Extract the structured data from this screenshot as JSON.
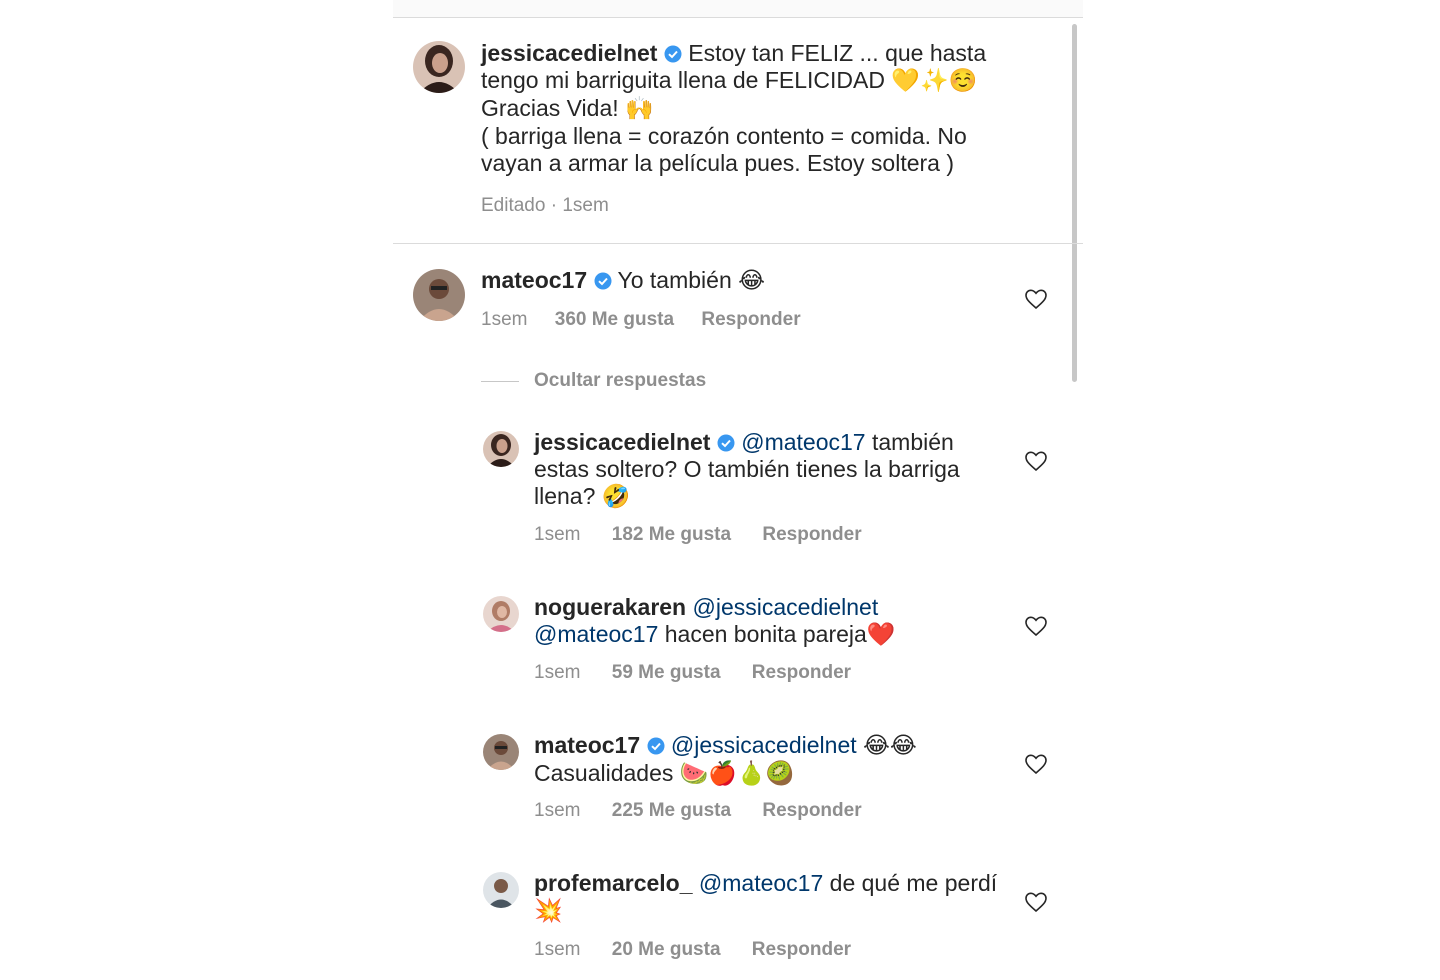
{
  "caption": {
    "username": "jessicacedielnet",
    "text_line1": "Estoy tan FELIZ ... que hasta tengo mi barriguita llena de FELICIDAD",
    "emoji1": "💛✨☺️",
    "text_line2": "Gracias Vida!",
    "emoji2": "🙌",
    "text_line3": "( barriga llena = corazón contento = comida. No vayan a armar la película pues. Estoy soltera )",
    "edited": "Editado",
    "dot": "·",
    "time": "1sem"
  },
  "comment_main": {
    "username": "mateoc17",
    "text": "Yo también",
    "emoji": "😂",
    "time": "1sem",
    "likes": "360 Me gusta",
    "reply": "Responder"
  },
  "hide_replies": "Ocultar respuestas",
  "replies": [
    {
      "username": "jessicacedielnet",
      "mention": "@mateoc17",
      "text": "también estas soltero? O también tienes la barriga llena?",
      "emoji": "🤣",
      "time": "1sem",
      "likes": "182 Me gusta",
      "reply": "Responder"
    },
    {
      "username": "noguerakaren",
      "mention": "@jessicacedielnet",
      "mention2": "@mateoc17",
      "text": "hacen bonita pareja",
      "emoji": "❤️",
      "time": "1sem",
      "likes": "59 Me gusta",
      "reply": "Responder"
    },
    {
      "username": "mateoc17",
      "mention": "@jessicacedielnet",
      "emoji": "😂😂",
      "text": "Casualidades",
      "emoji2": "🍉🍎🍐🥝",
      "time": "1sem",
      "likes": "225 Me gusta",
      "reply": "Responder"
    },
    {
      "username": "profemarcelo_",
      "mention": "@mateoc17",
      "text": "de qué me perdí",
      "emoji": "💥",
      "time": "1sem",
      "likes": "20 Me gusta",
      "reply": "Responder"
    }
  ],
  "colors": {
    "verified": "#3897f0",
    "mention": "#00376b",
    "secondary": "#8e8e8e"
  }
}
